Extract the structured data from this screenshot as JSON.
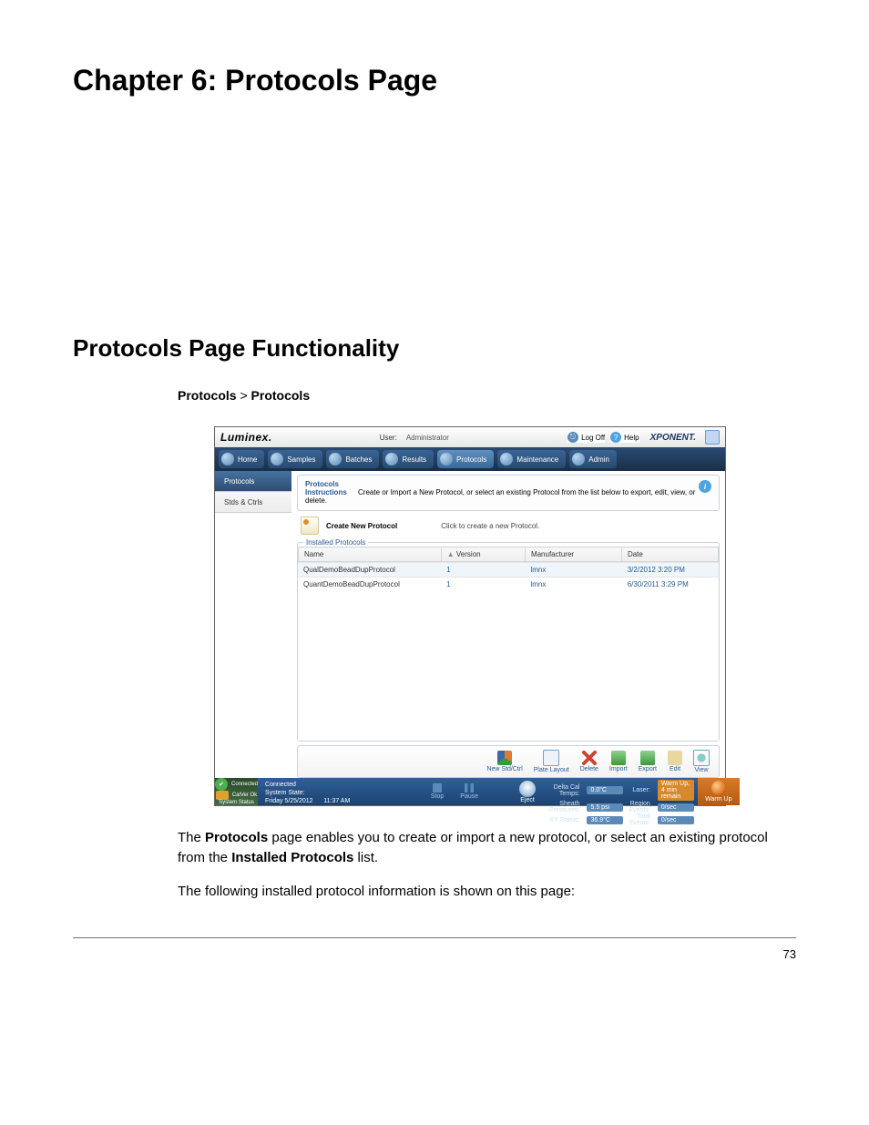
{
  "chapter_title": "Chapter 6: Protocols Page",
  "section_title": "Protocols Page Functionality",
  "breadcrumb": {
    "a": "Protocols",
    "sep": " > ",
    "b": "Protocols"
  },
  "page_number": "73",
  "para1_pre": "The ",
  "para1_b1": "Protocols",
  "para1_mid": " page enables you to create or import a new protocol, or select an existing protocol from the ",
  "para1_b2": "Installed Protocols",
  "para1_post": " list.",
  "para2": "The following installed protocol information is shown on this page:",
  "screenshot": {
    "brand": "Luminex.",
    "user_label": "User:",
    "user_name": "Administrator",
    "logoff": "Log Off",
    "help": "Help",
    "logo2": "XPONENT.",
    "tabs": {
      "home": "Home",
      "samples": "Samples",
      "batches": "Batches",
      "results": "Results",
      "protocols": "Protocols",
      "maintenance": "Maintenance",
      "admin": "Admin"
    },
    "sidebar": {
      "protocols": "Protocols",
      "stds": "Stds & Ctrls"
    },
    "pane_title1": "Protocols",
    "pane_title2": "Instructions",
    "pane_instr": "Create or Import a New Protocol, or select an existing Protocol from the list below to export, edit, view, or delete.",
    "create_label": "Create New Protocol",
    "create_hint": "Click to create a new Protocol.",
    "table_legend": "Installed Protocols",
    "table": {
      "headers": {
        "name": "Name",
        "version": "Version",
        "manufacturer": "Manufacturer",
        "date": "Date"
      },
      "rows": [
        {
          "name": "QualDemoBeadDupProtocol",
          "version": "1",
          "manufacturer": "lmnx",
          "date": "3/2/2012 3:20 PM"
        },
        {
          "name": "QuantDemoBeadDupProtocol",
          "version": "1",
          "manufacturer": "lmnx",
          "date": "6/30/2011 3:29 PM"
        }
      ]
    },
    "actions": {
      "new": "New Std/Ctrl",
      "plate": "Plate Layout",
      "delete": "Delete",
      "import": "Import",
      "export": "Export",
      "edit": "Edit",
      "view": "View"
    },
    "status": {
      "connected": "Connected",
      "calok": "CalVer Ok",
      "sysstatus": "System Status",
      "sysstate_label": "System State:",
      "datetime": "Friday 5/25/2012",
      "time": "11:37 AM",
      "stop": "Stop",
      "pause": "Pause",
      "eject": "Eject",
      "readouts": {
        "delta_cal_label": "Delta Cal Temps:",
        "delta_cal_val": "0.0°C",
        "sheath_label": "Sheath Pressures:",
        "sheath_val": "5.5 psi",
        "xy_label": "XY Status:",
        "xy_val": "36.9°C",
        "laser_label": "Laser:",
        "laser_val": "Warm Up, 4 min remain",
        "region_label": "Region Events:",
        "region_val": "0/sec",
        "total_label": "Total Events:",
        "total_val": "0/sec"
      },
      "warmup": "Warm Up"
    }
  }
}
